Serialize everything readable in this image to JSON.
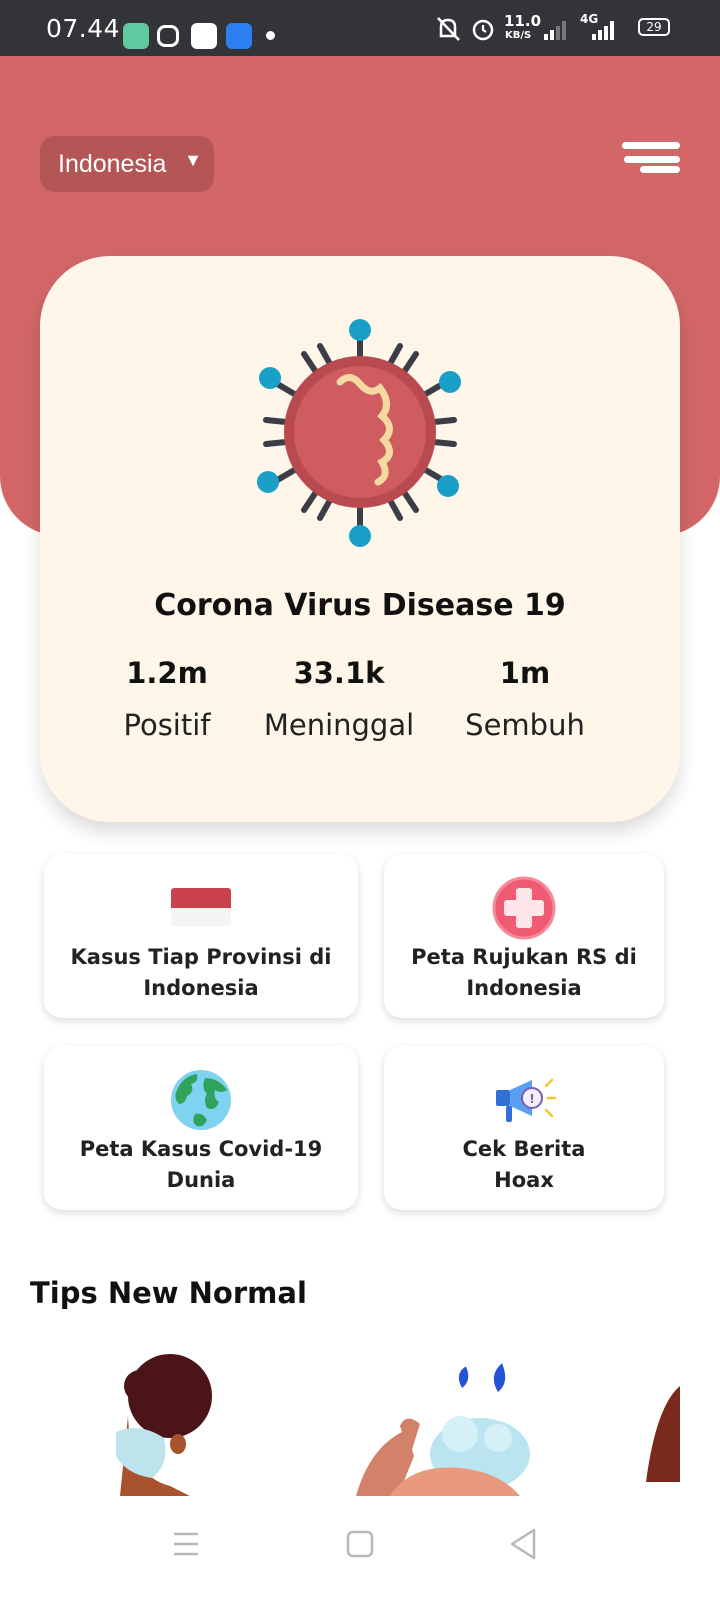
{
  "status_bar": {
    "time": "07.44",
    "net_speed_value": "11.0",
    "net_speed_unit": "KB/S",
    "network_type": "4G",
    "battery": "29"
  },
  "header": {
    "country_selected": "Indonesia",
    "caret": "▼"
  },
  "hero": {
    "title": "Corona Virus Disease 19",
    "stats": [
      {
        "value": "1.2m",
        "label": "Positif"
      },
      {
        "value": "33.1k",
        "label": "Meninggal"
      },
      {
        "value": "1m",
        "label": "Sembuh"
      }
    ]
  },
  "tiles": [
    {
      "line1": "Kasus Tiap Provinsi di",
      "line2": "Indonesia",
      "icon": "indonesia-flag-icon"
    },
    {
      "line1": "Peta Rujukan RS di",
      "line2": "Indonesia",
      "icon": "medical-cross-icon"
    },
    {
      "line1": "Peta Kasus Covid-19",
      "line2": "Dunia",
      "icon": "globe-icon"
    },
    {
      "line1": "Cek Berita",
      "line2": "Hoax",
      "icon": "megaphone-icon"
    }
  ],
  "tips": {
    "title": "Tips New Normal"
  },
  "colors": {
    "header_red": "#d36767",
    "card_bg": "#fff6ea",
    "select_bg": "#b45656"
  }
}
